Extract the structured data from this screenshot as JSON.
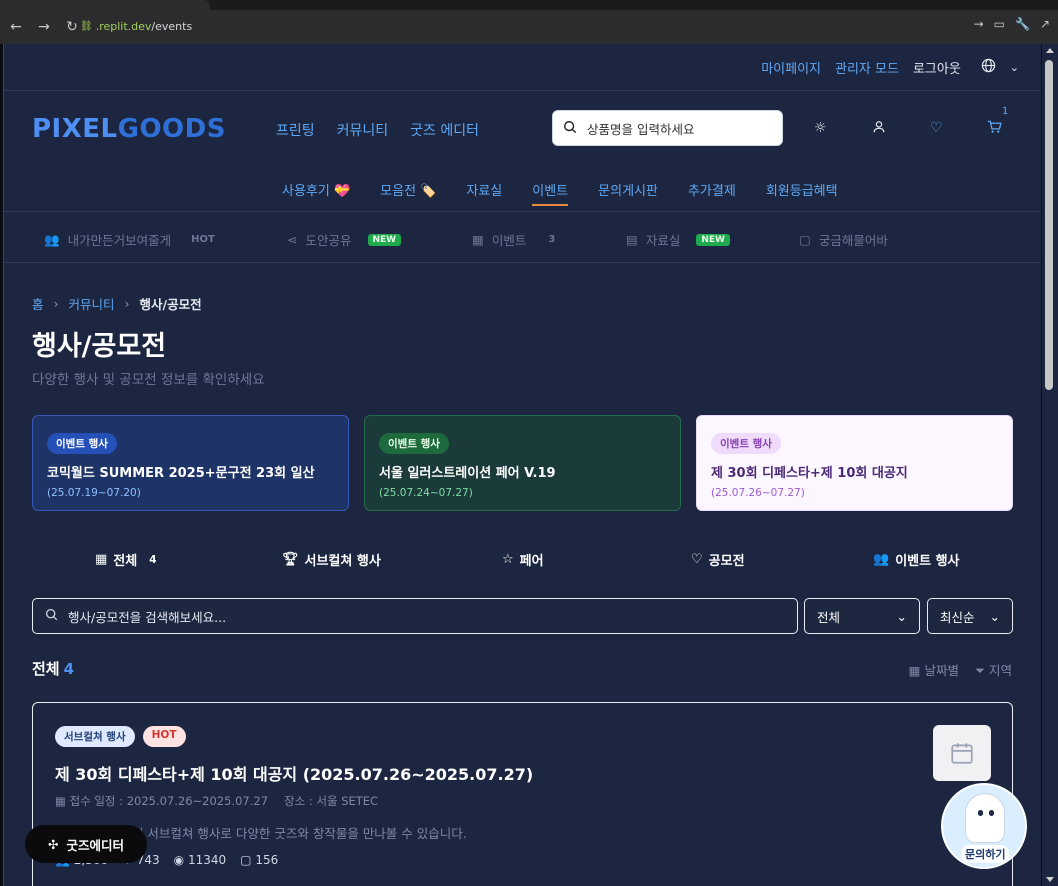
{
  "browser": {
    "url_scheme_domain": ".replit.dev",
    "url_path": "/events"
  },
  "toplinks": {
    "mypage": "마이페이지",
    "admin": "관리자 모드",
    "logout": "로그아웃"
  },
  "logo": {
    "part1": "PIXEL",
    "part2": "GOODS"
  },
  "mainnav": [
    "프린팅",
    "커뮤니티",
    "굿즈 에디터"
  ],
  "search": {
    "placeholder": "상품명을 입력하세요"
  },
  "cart_count": "1",
  "subnav": [
    "사용후기 💝",
    "모음전 🏷️",
    "자료실",
    "이벤트",
    "문의게시판",
    "추가결제",
    "회원등급혜택"
  ],
  "quick": [
    {
      "label": "내가만든거보여줄게",
      "tag": "HOT"
    },
    {
      "label": "도안공유",
      "tag": "NEW"
    },
    {
      "label": "이벤트",
      "tag": "3"
    },
    {
      "label": "자료실",
      "tag": "NEW"
    },
    {
      "label": "궁금해물어바",
      "tag": ""
    }
  ],
  "breadcrumb": {
    "home": "홈",
    "community": "커뮤니티",
    "current": "행사/공모전"
  },
  "page": {
    "title": "행사/공모전",
    "subtitle": "다양한 행사 및 공모전 정보를 확인하세요"
  },
  "featured": [
    {
      "tag": "이벤트 행사",
      "title": "코믹월드 SUMMER 2025+문구전 23회 일산",
      "date": "(25.07.19~07.20)"
    },
    {
      "tag": "이벤트 행사",
      "title": "서울 일러스트레이션 페어 V.19",
      "date": "(25.07.24~07.27)"
    },
    {
      "tag": "이벤트 행사",
      "title": "제 30회 디페스타+제 10회 대공지",
      "date": "(25.07.26~07.27)"
    }
  ],
  "categories": [
    {
      "label": "전체",
      "count": "4"
    },
    {
      "label": "서브컬쳐 행사",
      "count": ""
    },
    {
      "label": "페어",
      "count": ""
    },
    {
      "label": "공모전",
      "count": ""
    },
    {
      "label": "이벤트 행사",
      "count": ""
    }
  ],
  "listsearch": {
    "placeholder": "행사/공모전을 검색해보세요..."
  },
  "selects": {
    "filter": "전체",
    "sort": "최신순"
  },
  "total": {
    "label": "전체",
    "count": "4"
  },
  "filters": {
    "date": "날짜별",
    "region": "지역"
  },
  "item": {
    "tag1": "서브컬쳐 행사",
    "tag2": "HOT",
    "title": "제 30회 디페스타+제 10회 대공지 (2025.07.26~2025.07.27)",
    "period": "접수 일정 : 2025.07.26~2025.07.27",
    "place": "장소 : 서울 SETEC",
    "desc": "국내 최대 규모의 서브컬쳐 행사로 다양한 굿즈와 창작물을 만나볼 수 있습니다.",
    "participants": "2,500",
    "likes": "743",
    "views": "11340",
    "comments": "156"
  },
  "fab": {
    "label": "굿즈에디터"
  },
  "help": {
    "label": "문의하기"
  }
}
